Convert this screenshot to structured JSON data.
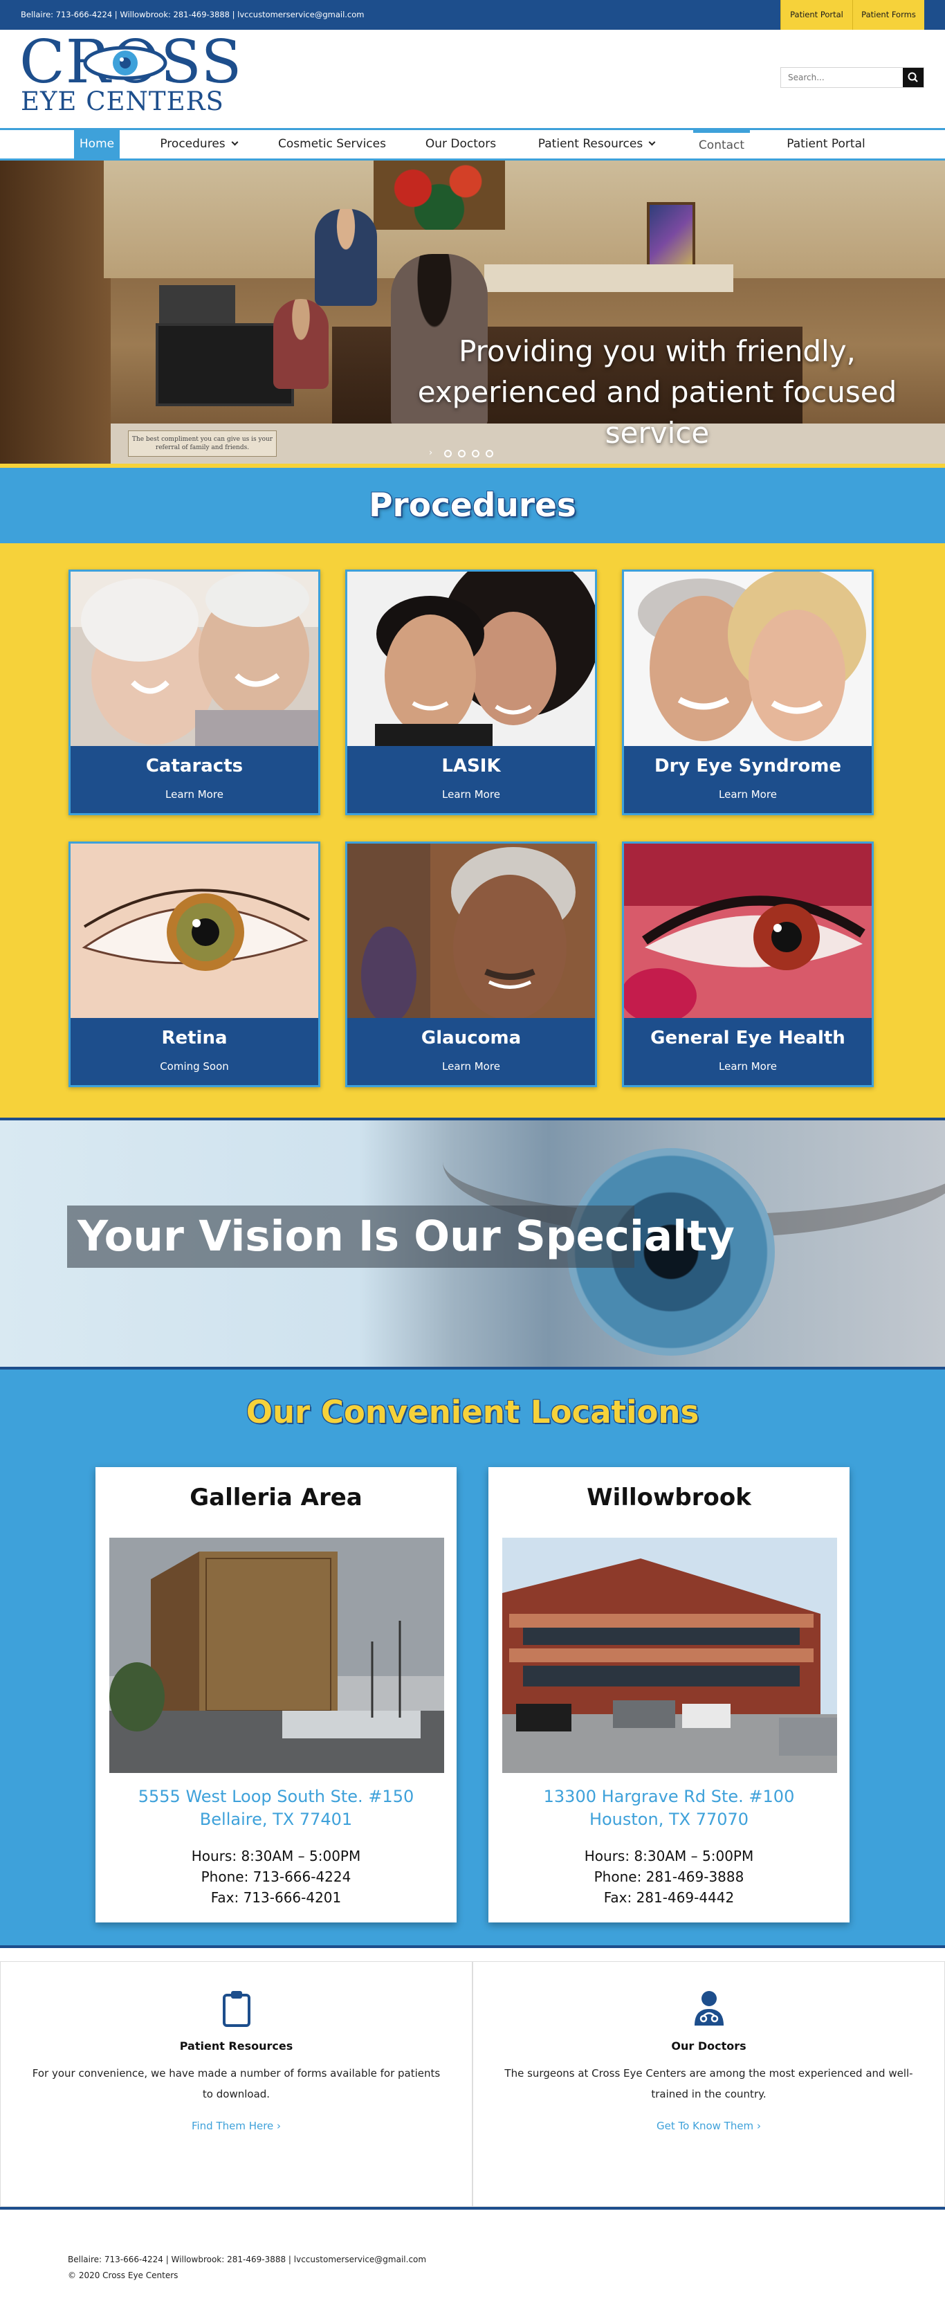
{
  "topbar": {
    "contact": "Bellaire: 713-666-4224 | Willowbrook: 281-469-3888  |  lvccustomerservice@gmail.com",
    "buttons": [
      "Patient Portal",
      "Patient Forms"
    ]
  },
  "logo": {
    "line1": "CROSS",
    "line2": "EYE CENTERS"
  },
  "search": {
    "placeholder": "Search..."
  },
  "nav": {
    "items": [
      "Home",
      "Procedures",
      "Cosmetic Services",
      "Our Doctors",
      "Patient Resources",
      "Contact",
      "Patient Portal"
    ]
  },
  "hero": {
    "caption": "Providing you with friendly, experienced and patient focused service",
    "sign": "The best compliment you can give us is your referral of family and friends.",
    "slide_count": 4
  },
  "procedures": {
    "title": "Procedures",
    "cards": [
      {
        "title": "Cataracts",
        "link": "Learn More"
      },
      {
        "title": "LASIK",
        "link": "Learn More"
      },
      {
        "title": "Dry Eye Syndrome",
        "link": "Learn More"
      },
      {
        "title": "Retina",
        "link": "Coming Soon"
      },
      {
        "title": "Glaucoma",
        "link": "Learn More"
      },
      {
        "title": "General Eye Health",
        "link": "Learn More"
      }
    ]
  },
  "vision": {
    "text": "Your Vision Is Our Specialty"
  },
  "locations": {
    "title": "Our Convenient Locations",
    "items": [
      {
        "name": "Galleria Area",
        "address1": "5555 West Loop South Ste. #150",
        "address2": "Bellaire, TX 77401",
        "hours": "Hours: 8:30AM – 5:00PM",
        "phone": "Phone: 713-666-4224",
        "fax": "Fax: 713-666-4201"
      },
      {
        "name": "Willowbrook",
        "address1": "13300 Hargrave Rd Ste. #100",
        "address2": "Houston, TX 77070",
        "hours": "Hours: 8:30AM – 5:00PM",
        "phone": "Phone: 281-469-3888",
        "fax": "Fax: 281-469-4442"
      }
    ]
  },
  "resources": [
    {
      "icon": "clipboard-icon",
      "title": "Patient Resources",
      "text": "For your convenience, we have made a number of forms available for patients to download.",
      "link": "Find Them Here ›"
    },
    {
      "icon": "doctor-icon",
      "title": "Our Doctors",
      "text": "The surgeons at Cross Eye Centers are among the most experienced and well-trained in the country.",
      "link": "Get To Know Them ›"
    }
  ],
  "footer": {
    "contact": "Bellaire: 713-666-4224 | Willowbrook: 281-469-3888 | lvccustomerservice@gmail.com",
    "copyright": "© 2020 Cross Eye Centers"
  },
  "colors": {
    "navy": "#1d4e8c",
    "sky": "#3ea1da",
    "yellow": "#f6d23a"
  }
}
